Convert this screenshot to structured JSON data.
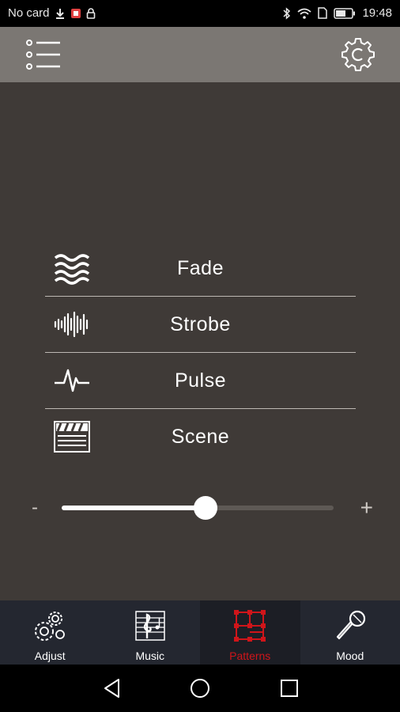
{
  "status_bar": {
    "carrier": "No card",
    "time": "19:48"
  },
  "app_bar": {
    "menu_icon": "list-menu-icon",
    "settings_icon": "gear-c-icon"
  },
  "patterns": [
    {
      "label": "Fade",
      "icon": "waves-icon"
    },
    {
      "label": "Strobe",
      "icon": "sound-wave-icon"
    },
    {
      "label": "Pulse",
      "icon": "pulse-icon"
    },
    {
      "label": "Scene",
      "icon": "clapperboard-icon"
    }
  ],
  "slider": {
    "minus_label": "-",
    "plus_label": "+",
    "value_fraction": 0.53
  },
  "tabs": [
    {
      "label": "Adjust",
      "icon": "gears-icon",
      "active": false
    },
    {
      "label": "Music",
      "icon": "music-sheet-icon",
      "active": false
    },
    {
      "label": "Patterns",
      "icon": "grid-pattern-icon",
      "active": true
    },
    {
      "label": "Mood",
      "icon": "microphone-icon",
      "active": false
    }
  ],
  "colors": {
    "background": "#3f3a37",
    "app_bar": "#7b7773",
    "tab_bar": "#242730",
    "active_accent": "#d0151a"
  }
}
